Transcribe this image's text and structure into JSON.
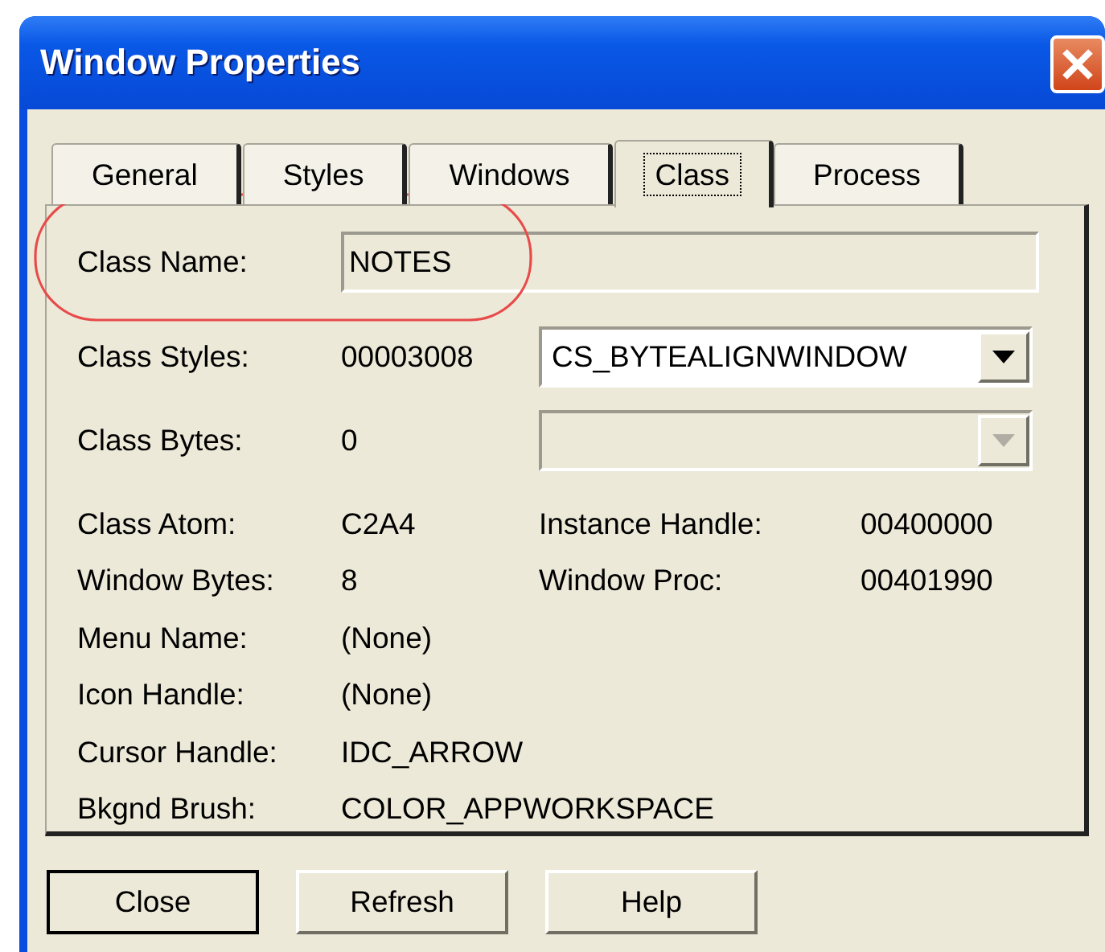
{
  "window": {
    "title": "Window Properties"
  },
  "tabs": [
    {
      "label": "General",
      "selected": false
    },
    {
      "label": "Styles",
      "selected": false
    },
    {
      "label": "Windows",
      "selected": false
    },
    {
      "label": "Class",
      "selected": true
    },
    {
      "label": "Process",
      "selected": false
    }
  ],
  "class_name": {
    "label": "Class Name:",
    "value": "NOTES"
  },
  "class_styles": {
    "label": "Class Styles:",
    "value": "00003008",
    "combo": {
      "value": "CS_BYTEALIGNWINDOW",
      "disabled": false
    }
  },
  "class_bytes": {
    "label": "Class Bytes:",
    "value": "0",
    "combo": {
      "disabled": true
    }
  },
  "rows": [
    {
      "label": "Class Atom:",
      "value": "C2A4",
      "label_2": "Instance Handle:",
      "value_2": "00400000"
    },
    {
      "label": "Window Bytes:",
      "value": "8",
      "label_2": "Window Proc:",
      "value_2": "00401990"
    },
    {
      "label": "Menu Name:",
      "value": "(None)"
    },
    {
      "label": "Icon Handle:",
      "value": "(None)"
    },
    {
      "label": "Cursor Handle:",
      "value": "IDC_ARROW"
    },
    {
      "label": "Bkgnd Brush:",
      "value": "COLOR_APPWORKSPACE"
    }
  ],
  "buttons": [
    {
      "label": "Close",
      "default": true
    },
    {
      "label": "Refresh",
      "default": false
    },
    {
      "label": "Help",
      "default": false
    }
  ]
}
